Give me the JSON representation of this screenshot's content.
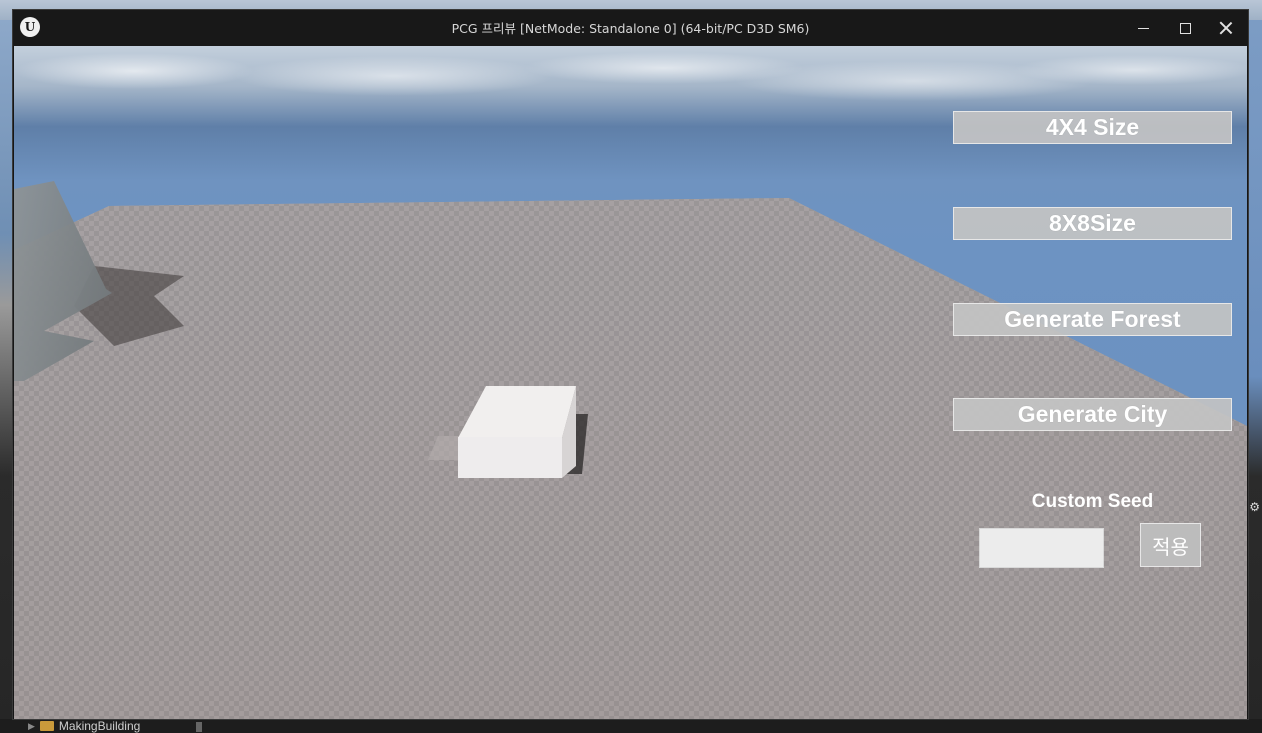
{
  "window": {
    "title": "PCG 프리뷰 [NetMode: Standalone 0]  (64-bit/PC D3D SM6)",
    "logo_icon": "unreal-logo-icon",
    "minimize_icon": "minimize-icon",
    "maximize_icon": "maximize-icon",
    "close_icon": "close-icon"
  },
  "ui": {
    "btn_4x4": "4X4 Size",
    "btn_8x8": "8X8Size",
    "btn_forest": "Generate Forest",
    "btn_city": "Generate City",
    "seed_label": "Custom Seed",
    "seed_value": "",
    "apply_label": "적용"
  },
  "background": {
    "folder_label": "MakingBuilding",
    "folder_icon": "folder-icon"
  }
}
